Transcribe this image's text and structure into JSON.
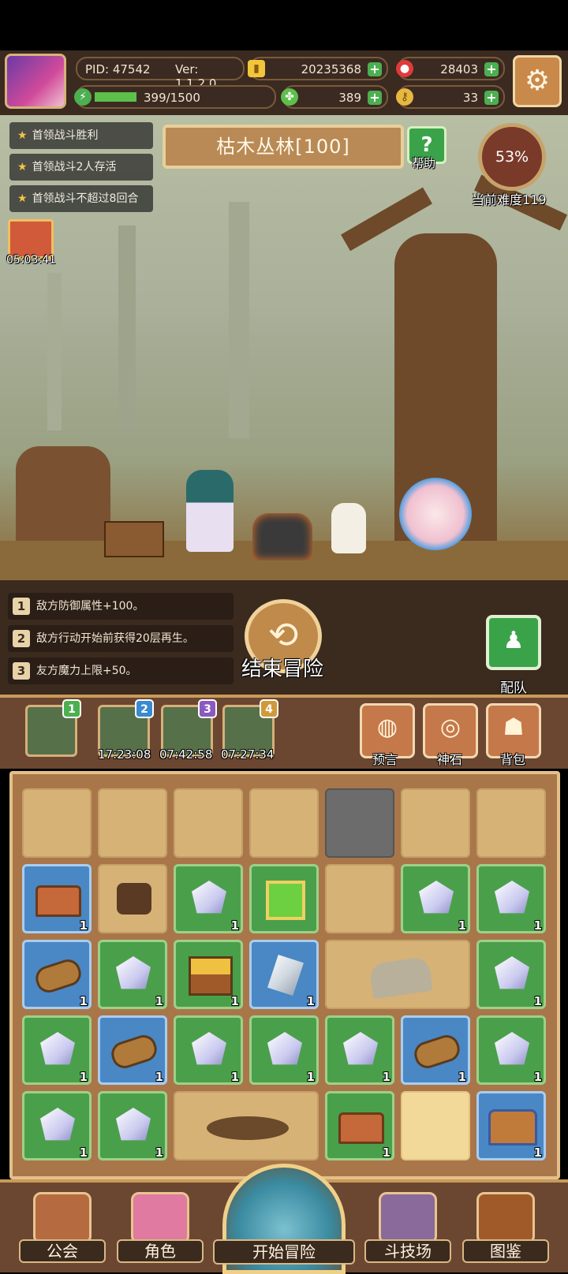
{
  "header": {
    "pid": "PID: 47542",
    "version": "Ver: 1.1.2.0",
    "gold": "20235368",
    "ruby": "28403",
    "energy": "399/1500",
    "energy_fraction": 0.266,
    "clover": "389",
    "keys": "33"
  },
  "tasks": [
    {
      "label": "首领战斗胜利"
    },
    {
      "label": "首领战斗2人存活"
    },
    {
      "label": "首领战斗不超过8回合"
    }
  ],
  "timer": "05:03:41",
  "stage": {
    "title": "枯木丛林[100]",
    "help_label": "帮助",
    "difficulty_percent": "53%",
    "difficulty_label": "当前难度119"
  },
  "effects": [
    {
      "num": "1",
      "text": "敌方防御属性+100。"
    },
    {
      "num": "2",
      "text": "敌方行动开始前获得20层再生。"
    },
    {
      "num": "3",
      "text": "友方魔力上限+50。"
    }
  ],
  "end_adventure_label": "结束冒险",
  "team_label": "配队",
  "slots": [
    {
      "badge": "1",
      "time": ""
    },
    {
      "badge": "2",
      "time": "17:23:08"
    },
    {
      "badge": "3",
      "time": "07:42:58"
    },
    {
      "badge": "4",
      "time": "07:27:34"
    }
  ],
  "side_buttons": [
    {
      "label": "预言"
    },
    {
      "label": "神石"
    },
    {
      "label": "背包"
    }
  ],
  "grid_counts": {
    "one": "1"
  },
  "nav": {
    "guild": "公会",
    "role": "角色",
    "start": "开始冒险",
    "arena": "斗技场",
    "codex": "图鉴"
  }
}
